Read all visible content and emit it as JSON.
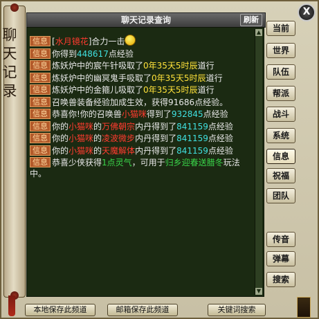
{
  "window": {
    "title": "聊天记录查询",
    "refresh_label": "刷新",
    "close_label": "X",
    "side_title": "聊天记录"
  },
  "tabs": [
    {
      "label": "当前",
      "active": false
    },
    {
      "label": "世界",
      "active": false
    },
    {
      "label": "队伍",
      "active": false
    },
    {
      "label": "帮派",
      "active": false
    },
    {
      "label": "战斗",
      "active": false
    },
    {
      "label": "系统",
      "active": false
    },
    {
      "label": "信息",
      "active": true
    },
    {
      "label": "祝福",
      "active": false
    },
    {
      "label": "团队",
      "active": false
    },
    {
      "label": "传音",
      "active": false
    },
    {
      "label": "弹幕",
      "active": false
    },
    {
      "label": "搜索",
      "active": false
    }
  ],
  "tag_label": "信息",
  "messages": [
    {
      "parts": [
        {
          "t": "[",
          "c": "w"
        },
        {
          "t": "水月镜花",
          "c": "r"
        },
        {
          "t": "]合力一击",
          "c": "w"
        }
      ],
      "emoji": "smile-icon"
    },
    {
      "parts": [
        {
          "t": "你得到",
          "c": "w"
        },
        {
          "t": "448617",
          "c": "c"
        },
        {
          "t": "点经验",
          "c": "w"
        }
      ]
    },
    {
      "parts": [
        {
          "t": "炼妖炉中的宸午针吸取了",
          "c": "w"
        },
        {
          "t": "0年35天5时辰",
          "c": "y"
        },
        {
          "t": "道行",
          "c": "w"
        }
      ]
    },
    {
      "parts": [
        {
          "t": "炼妖炉中的幽冥鬼手吸取了",
          "c": "w"
        },
        {
          "t": "0年35天5时辰",
          "c": "y"
        },
        {
          "t": "道行",
          "c": "w"
        }
      ]
    },
    {
      "parts": [
        {
          "t": "炼妖炉中的金箍儿吸取了",
          "c": "w"
        },
        {
          "t": "0年35天5时辰",
          "c": "y"
        },
        {
          "t": "道行",
          "c": "w"
        }
      ]
    },
    {
      "parts": [
        {
          "t": "召唤兽装备经验加成生效，获得91686点经验。",
          "c": "w"
        }
      ]
    },
    {
      "parts": [
        {
          "t": "恭喜你!你的召唤兽",
          "c": "w"
        },
        {
          "t": "小猫咪",
          "c": "r"
        },
        {
          "t": "得到了",
          "c": "w"
        },
        {
          "t": "932845",
          "c": "c"
        },
        {
          "t": "点经验",
          "c": "w"
        }
      ]
    },
    {
      "parts": [
        {
          "t": "你的",
          "c": "w"
        },
        {
          "t": "小猫咪",
          "c": "r"
        },
        {
          "t": "的",
          "c": "w"
        },
        {
          "t": "万佛朝宗",
          "c": "r"
        },
        {
          "t": "内丹得到了",
          "c": "w"
        },
        {
          "t": "841159",
          "c": "c"
        },
        {
          "t": "点经验",
          "c": "w"
        }
      ]
    },
    {
      "parts": [
        {
          "t": "你的",
          "c": "w"
        },
        {
          "t": "小猫咪",
          "c": "r"
        },
        {
          "t": "的",
          "c": "w"
        },
        {
          "t": "凌波微步",
          "c": "r"
        },
        {
          "t": "内丹得到了",
          "c": "w"
        },
        {
          "t": "841159",
          "c": "c"
        },
        {
          "t": "点经验",
          "c": "w"
        }
      ]
    },
    {
      "parts": [
        {
          "t": "你的",
          "c": "w"
        },
        {
          "t": "小猫咪",
          "c": "r"
        },
        {
          "t": "的",
          "c": "w"
        },
        {
          "t": "天魔解体",
          "c": "r"
        },
        {
          "t": "内丹得到了",
          "c": "w"
        },
        {
          "t": "841159",
          "c": "c"
        },
        {
          "t": "点经验",
          "c": "w"
        }
      ]
    },
    {
      "parts": [
        {
          "t": "恭喜少侠获得",
          "c": "w"
        },
        {
          "t": "1点灵气",
          "c": "g"
        },
        {
          "t": "，可用于",
          "c": "w"
        },
        {
          "t": "归乡迎春送腊冬",
          "c": "g"
        },
        {
          "t": "玩法中。",
          "c": "w"
        }
      ]
    }
  ],
  "bottom_buttons": [
    {
      "label": "本地保存此频道"
    },
    {
      "label": "邮箱保存此频道"
    },
    {
      "label": "关键词搜索"
    }
  ],
  "colors": {
    "panel_bg": "#1b2a12",
    "tag_bg": "#b35a2a",
    "highlight_yellow": "#ffe23a",
    "highlight_red": "#ff3b2f",
    "highlight_cyan": "#40e0e0",
    "highlight_green": "#3ad64a"
  }
}
